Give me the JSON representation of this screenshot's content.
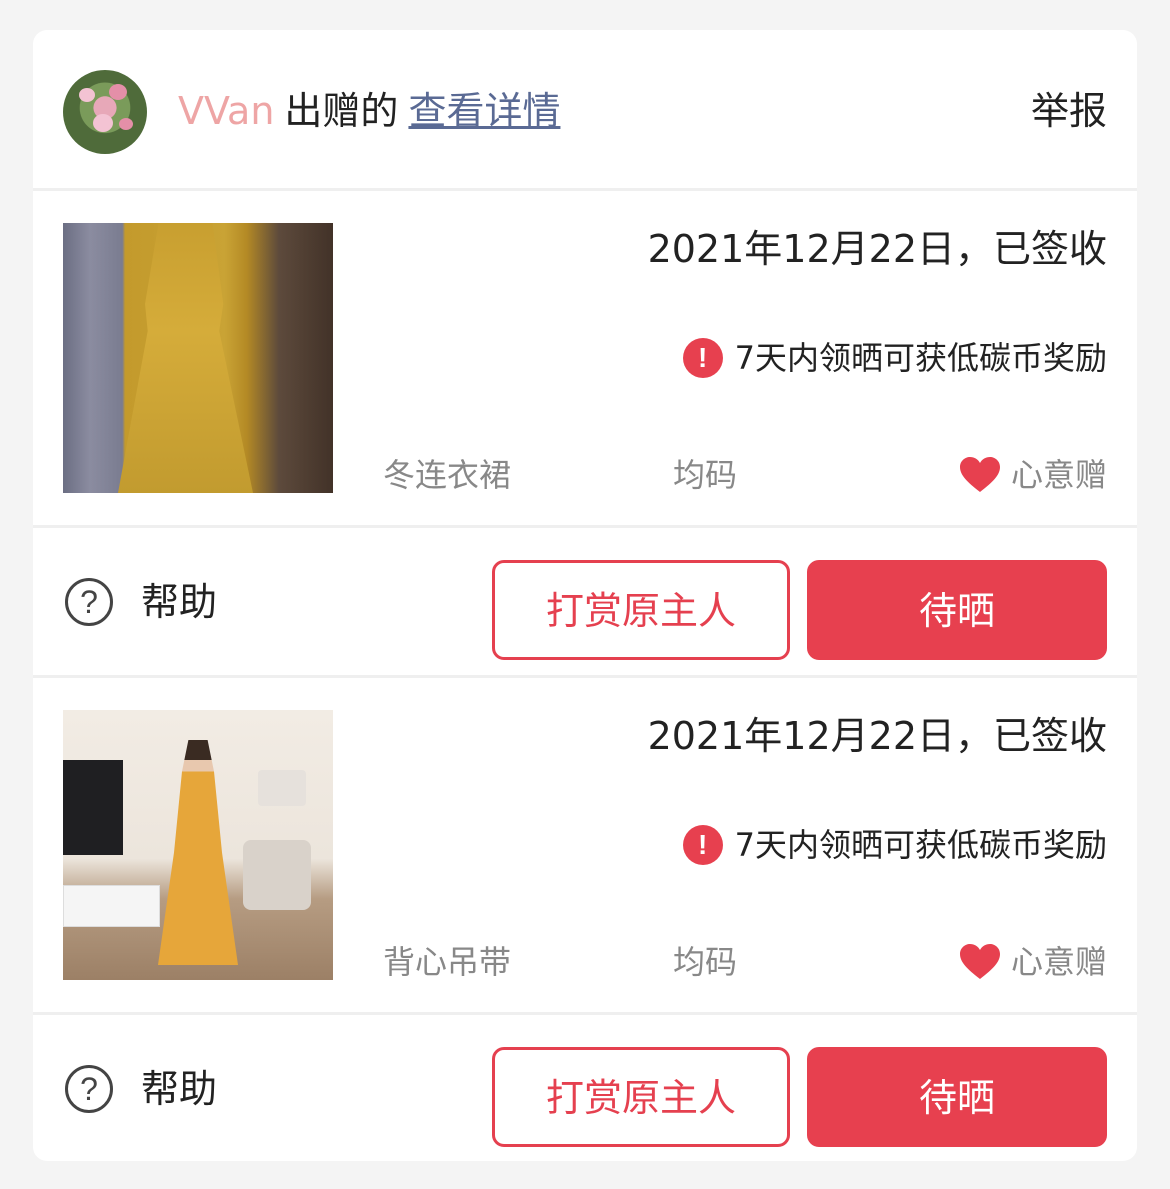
{
  "header": {
    "username": "VVan",
    "gift_text": "出赠的",
    "detail_link": "查看详情",
    "report": "举报",
    "avatar_icon": "flower-avatar"
  },
  "items": [
    {
      "date_status": "2021年12月22日，已签收",
      "reward_text": "7天内领晒可获低碳币奖励",
      "warn_glyph": "!",
      "category": "冬连衣裙",
      "size": "均码",
      "tag": "心意赠",
      "help_label": "帮助",
      "help_glyph": "?",
      "tip_button": "打赏原主人",
      "pending_button": "待晒"
    },
    {
      "date_status": "2021年12月22日，已签收",
      "reward_text": "7天内领晒可获低碳币奖励",
      "warn_glyph": "!",
      "category": "背心吊带",
      "size": "均码",
      "tag": "心意赠",
      "help_label": "帮助",
      "help_glyph": "?",
      "tip_button": "打赏原主人",
      "pending_button": "待晒"
    }
  ],
  "colors": {
    "accent": "#e7404f",
    "username": "#eea5a5",
    "link": "#5a6a94",
    "muted": "#888888"
  }
}
